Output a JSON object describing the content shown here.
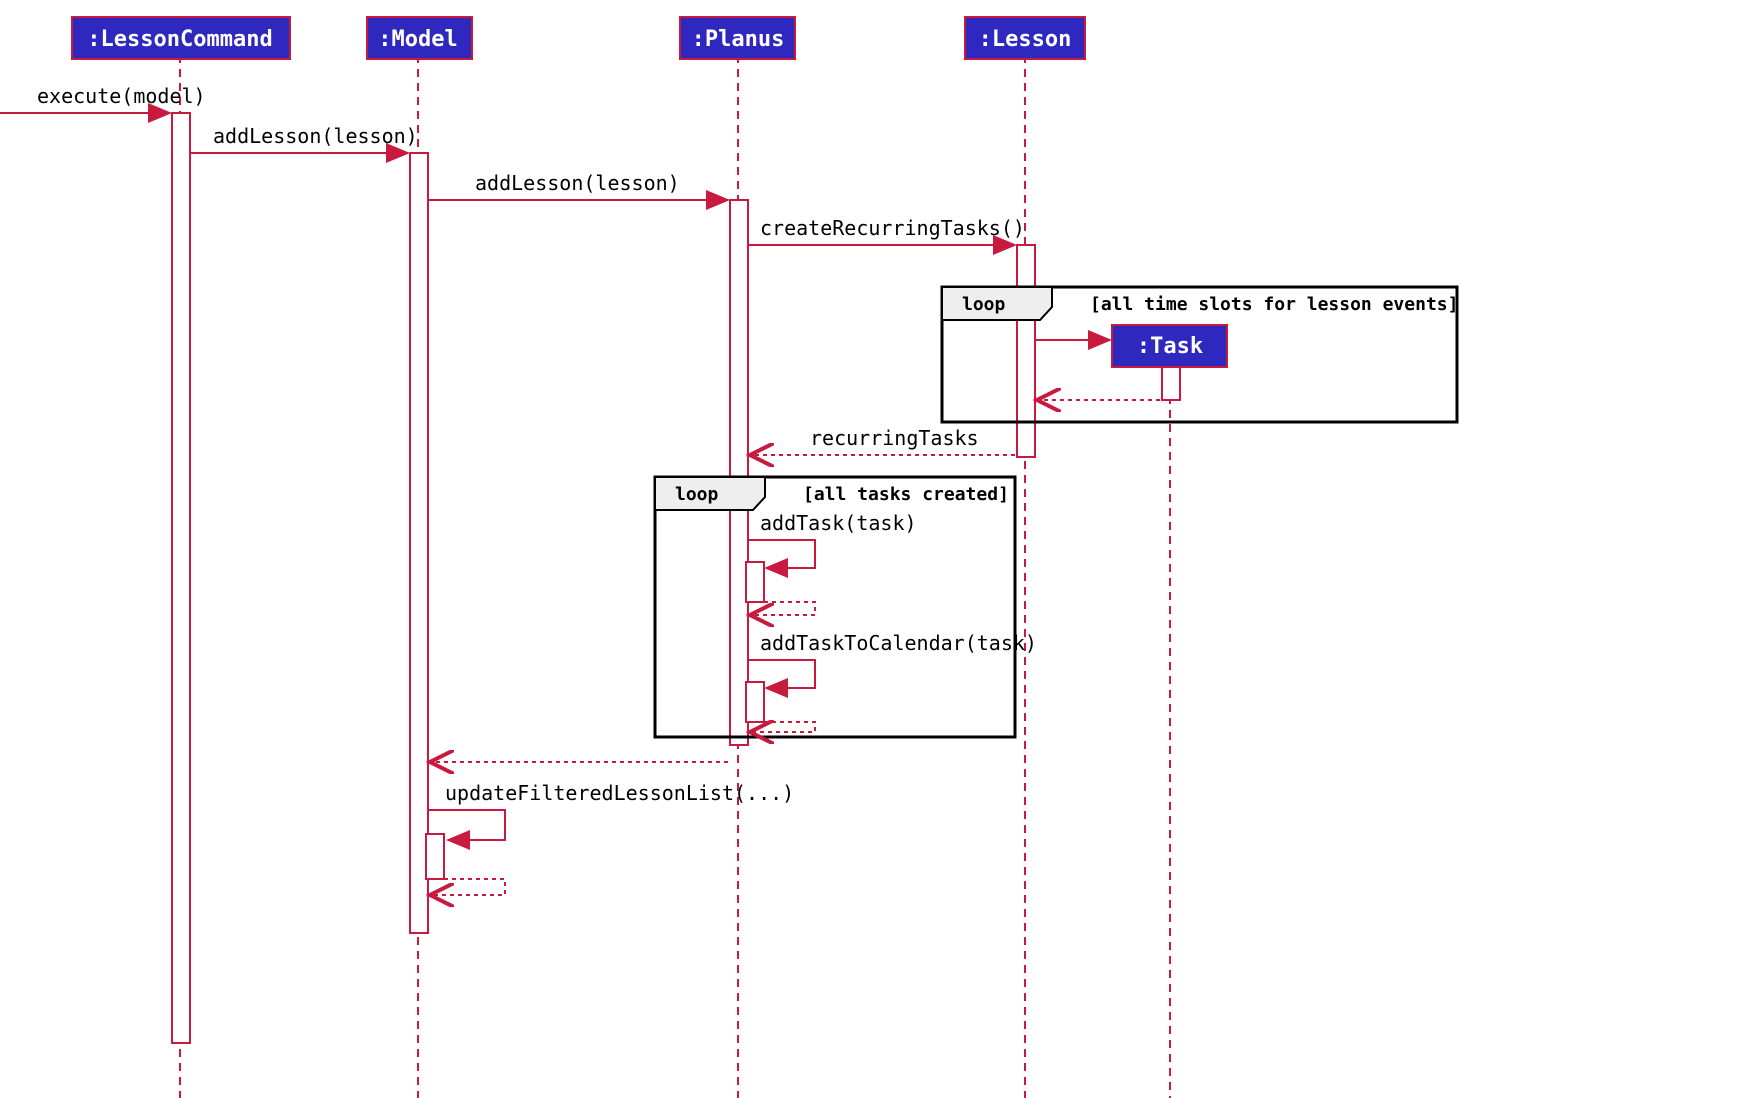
{
  "participants": {
    "lessonCommand": ":LessonCommand",
    "model": ":Model",
    "planus": ":Planus",
    "lesson": ":Lesson",
    "task": ":Task"
  },
  "messages": {
    "execute": "execute(model)",
    "addLesson1": "addLesson(lesson)",
    "addLesson2": "addLesson(lesson)",
    "createRecurring": "createRecurringTasks()",
    "recurringTasks": "recurringTasks",
    "addTask": "addTask(task)",
    "addTaskCal": "addTaskToCalendar(task)",
    "updateFiltered": "updateFilteredLessonList(...)"
  },
  "loops": {
    "loop1_label": "loop",
    "loop1_cond": "[all time slots for lesson events]",
    "loop2_label": "loop",
    "loop2_cond": "[all tasks created]"
  }
}
